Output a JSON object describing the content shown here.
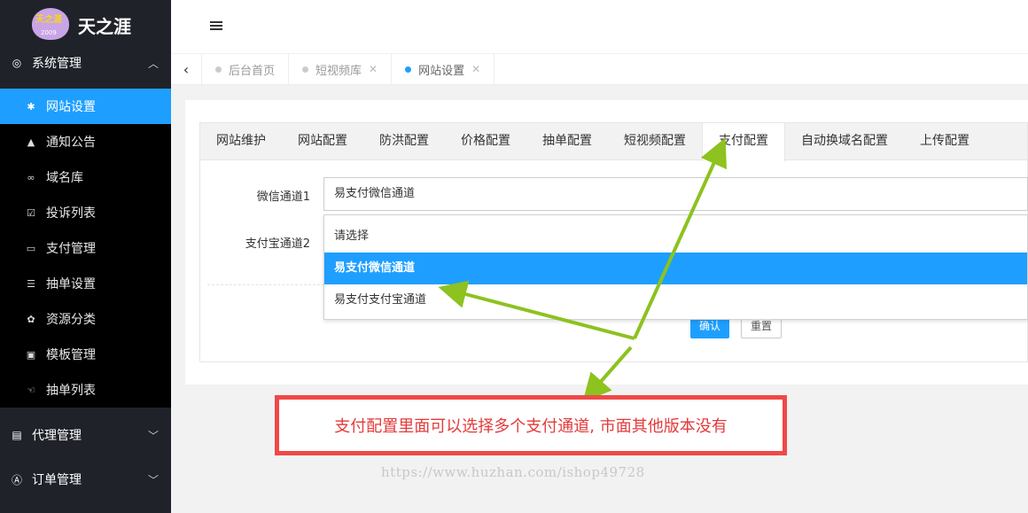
{
  "brand": {
    "title": "天之涯",
    "badge_text": "天之涯",
    "badge_year": "2009"
  },
  "sidebar": {
    "group_system": {
      "label": "系统管理",
      "icon": "target-icon"
    },
    "items": [
      {
        "label": "网站设置",
        "icon": "gear-icon",
        "active": true
      },
      {
        "label": "通知公告",
        "icon": "bell-icon"
      },
      {
        "label": "域名库",
        "icon": "link-icon"
      },
      {
        "label": "投诉列表",
        "icon": "check-icon"
      },
      {
        "label": "支付管理",
        "icon": "paypal-icon"
      },
      {
        "label": "抽单设置",
        "icon": "layers-icon"
      },
      {
        "label": "资源分类",
        "icon": "plant-icon"
      },
      {
        "label": "模板管理",
        "icon": "html5-icon"
      },
      {
        "label": "抽单列表",
        "icon": "hand-icon"
      }
    ],
    "group_agent": {
      "label": "代理管理",
      "icon": "contact-icon"
    },
    "group_order": {
      "label": "订单管理",
      "icon": "letter-a-icon"
    }
  },
  "page_tabs": [
    {
      "label": "后台首页",
      "closable": false,
      "active": false
    },
    {
      "label": "短视频库",
      "closable": true,
      "active": false
    },
    {
      "label": "网站设置",
      "closable": true,
      "active": true
    }
  ],
  "content_tabs": [
    {
      "label": "网站维护"
    },
    {
      "label": "网站配置"
    },
    {
      "label": "防洪配置"
    },
    {
      "label": "价格配置"
    },
    {
      "label": "抽单配置"
    },
    {
      "label": "短视频配置"
    },
    {
      "label": "支付配置",
      "active": true
    },
    {
      "label": "自动换域名配置"
    },
    {
      "label": "上传配置"
    }
  ],
  "form": {
    "wechat_label": "微信通道1",
    "wechat_value": "易支付微信通道",
    "alipay_label": "支付宝通道2",
    "dropdown_options": [
      {
        "label": "请选择"
      },
      {
        "label": "易支付微信通道",
        "selected": true
      },
      {
        "label": "易支付支付宝通道"
      }
    ],
    "confirm_label": "确认",
    "reset_label": "重置"
  },
  "annotation": {
    "callout_text": "支付配置里面可以选择多个支付通道, 市面其他版本没有"
  },
  "watermark": "https://www.huzhan.com/ishop49728",
  "colors": {
    "accent": "#1e9fff",
    "sidebar_bg": "#20222a",
    "callout_red": "#f04848",
    "arrow_green": "#8dc21f"
  }
}
